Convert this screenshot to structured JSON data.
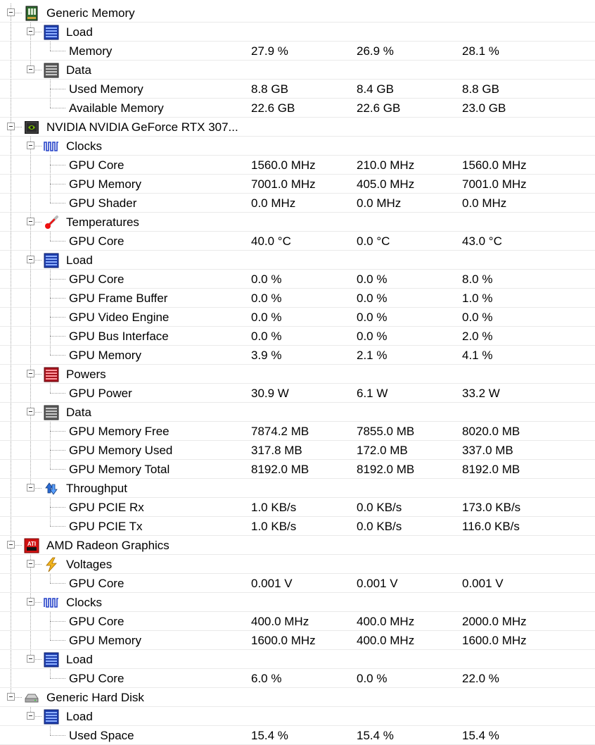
{
  "tree": [
    {
      "kind": "hw",
      "label": "Generic Memory",
      "icon": "memory-chip-icon",
      "groups": [
        {
          "label": "Load",
          "icon": "load-bars-icon",
          "sensors": [
            {
              "label": "Memory",
              "values": [
                "27.9 %",
                "26.9 %",
                "28.1 %"
              ]
            }
          ]
        },
        {
          "label": "Data",
          "icon": "data-bars-icon",
          "sensors": [
            {
              "label": "Used Memory",
              "values": [
                "8.8 GB",
                "8.4 GB",
                "8.8 GB"
              ]
            },
            {
              "label": "Available Memory",
              "values": [
                "22.6 GB",
                "22.6 GB",
                "23.0 GB"
              ]
            }
          ]
        }
      ]
    },
    {
      "kind": "hw",
      "label": "NVIDIA NVIDIA GeForce RTX 307...",
      "icon": "nvidia-gpu-icon",
      "groups": [
        {
          "label": "Clocks",
          "icon": "clock-wave-icon",
          "sensors": [
            {
              "label": "GPU Core",
              "values": [
                "1560.0 MHz",
                "210.0 MHz",
                "1560.0 MHz"
              ]
            },
            {
              "label": "GPU Memory",
              "values": [
                "7001.0 MHz",
                "405.0 MHz",
                "7001.0 MHz"
              ]
            },
            {
              "label": "GPU Shader",
              "values": [
                "0.0 MHz",
                "0.0 MHz",
                "0.0 MHz"
              ]
            }
          ]
        },
        {
          "label": "Temperatures",
          "icon": "thermometer-icon",
          "sensors": [
            {
              "label": "GPU Core",
              "values": [
                "40.0 °C",
                "0.0 °C",
                "43.0 °C"
              ]
            }
          ]
        },
        {
          "label": "Load",
          "icon": "load-bars-icon",
          "sensors": [
            {
              "label": "GPU Core",
              "values": [
                "0.0 %",
                "0.0 %",
                "8.0 %"
              ]
            },
            {
              "label": "GPU Frame Buffer",
              "values": [
                "0.0 %",
                "0.0 %",
                "1.0 %"
              ]
            },
            {
              "label": "GPU Video Engine",
              "values": [
                "0.0 %",
                "0.0 %",
                "0.0 %"
              ]
            },
            {
              "label": "GPU Bus Interface",
              "values": [
                "0.0 %",
                "0.0 %",
                "2.0 %"
              ]
            },
            {
              "label": "GPU Memory",
              "values": [
                "3.9 %",
                "2.1 %",
                "4.1 %"
              ]
            }
          ]
        },
        {
          "label": "Powers",
          "icon": "power-bars-icon",
          "sensors": [
            {
              "label": "GPU Power",
              "values": [
                "30.9 W",
                "6.1 W",
                "33.2 W"
              ]
            }
          ]
        },
        {
          "label": "Data",
          "icon": "data-bars-icon",
          "sensors": [
            {
              "label": "GPU Memory Free",
              "values": [
                "7874.2 MB",
                "7855.0 MB",
                "8020.0 MB"
              ]
            },
            {
              "label": "GPU Memory Used",
              "values": [
                "317.8 MB",
                "172.0 MB",
                "337.0 MB"
              ]
            },
            {
              "label": "GPU Memory Total",
              "values": [
                "8192.0 MB",
                "8192.0 MB",
                "8192.0 MB"
              ]
            }
          ]
        },
        {
          "label": "Throughput",
          "icon": "throughput-arrows-icon",
          "sensors": [
            {
              "label": "GPU PCIE Rx",
              "values": [
                "1.0 KB/s",
                "0.0 KB/s",
                "173.0 KB/s"
              ]
            },
            {
              "label": "GPU PCIE Tx",
              "values": [
                "1.0 KB/s",
                "0.0 KB/s",
                "116.0 KB/s"
              ]
            }
          ]
        }
      ]
    },
    {
      "kind": "hw",
      "label": "AMD Radeon Graphics",
      "icon": "ati-gpu-icon",
      "groups": [
        {
          "label": "Voltages",
          "icon": "lightning-icon",
          "sensors": [
            {
              "label": "GPU Core",
              "values": [
                "0.001 V",
                "0.001 V",
                "0.001 V"
              ]
            }
          ]
        },
        {
          "label": "Clocks",
          "icon": "clock-wave-icon",
          "sensors": [
            {
              "label": "GPU Core",
              "values": [
                "400.0 MHz",
                "400.0 MHz",
                "2000.0 MHz"
              ]
            },
            {
              "label": "GPU Memory",
              "values": [
                "1600.0 MHz",
                "400.0 MHz",
                "1600.0 MHz"
              ]
            }
          ]
        },
        {
          "label": "Load",
          "icon": "load-bars-icon",
          "sensors": [
            {
              "label": "GPU Core",
              "values": [
                "6.0 %",
                "0.0 %",
                "22.0 %"
              ]
            }
          ]
        }
      ]
    },
    {
      "kind": "hw",
      "label": "Generic Hard Disk",
      "icon": "hard-disk-icon",
      "groups": [
        {
          "label": "Load",
          "icon": "load-bars-icon",
          "sensors": [
            {
              "label": "Used Space",
              "values": [
                "15.4 %",
                "15.4 %",
                "15.4 %"
              ]
            }
          ]
        }
      ]
    }
  ]
}
